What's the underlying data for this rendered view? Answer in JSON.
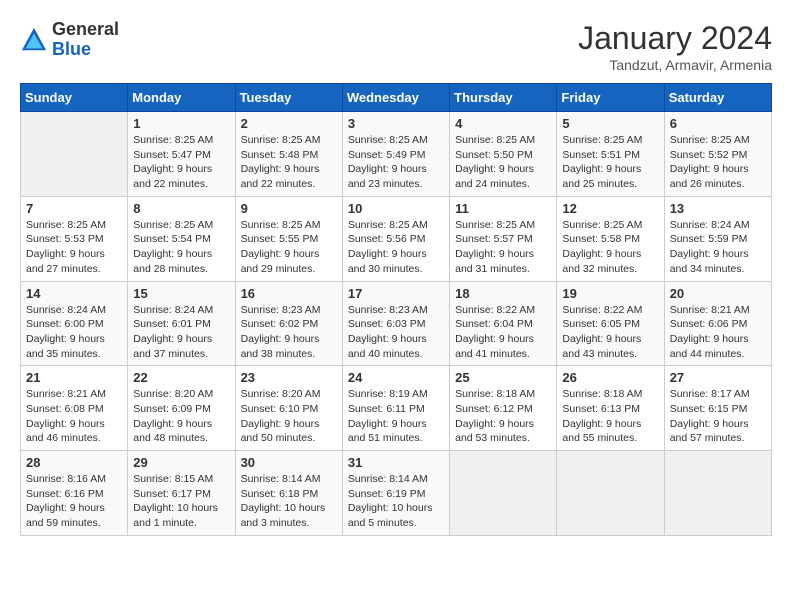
{
  "header": {
    "logo_general": "General",
    "logo_blue": "Blue",
    "month_title": "January 2024",
    "location": "Tandzut, Armavir, Armenia"
  },
  "days_of_week": [
    "Sunday",
    "Monday",
    "Tuesday",
    "Wednesday",
    "Thursday",
    "Friday",
    "Saturday"
  ],
  "weeks": [
    [
      {
        "day": "",
        "info": ""
      },
      {
        "day": "1",
        "info": "Sunrise: 8:25 AM\nSunset: 5:47 PM\nDaylight: 9 hours\nand 22 minutes."
      },
      {
        "day": "2",
        "info": "Sunrise: 8:25 AM\nSunset: 5:48 PM\nDaylight: 9 hours\nand 22 minutes."
      },
      {
        "day": "3",
        "info": "Sunrise: 8:25 AM\nSunset: 5:49 PM\nDaylight: 9 hours\nand 23 minutes."
      },
      {
        "day": "4",
        "info": "Sunrise: 8:25 AM\nSunset: 5:50 PM\nDaylight: 9 hours\nand 24 minutes."
      },
      {
        "day": "5",
        "info": "Sunrise: 8:25 AM\nSunset: 5:51 PM\nDaylight: 9 hours\nand 25 minutes."
      },
      {
        "day": "6",
        "info": "Sunrise: 8:25 AM\nSunset: 5:52 PM\nDaylight: 9 hours\nand 26 minutes."
      }
    ],
    [
      {
        "day": "7",
        "info": "Sunrise: 8:25 AM\nSunset: 5:53 PM\nDaylight: 9 hours\nand 27 minutes."
      },
      {
        "day": "8",
        "info": "Sunrise: 8:25 AM\nSunset: 5:54 PM\nDaylight: 9 hours\nand 28 minutes."
      },
      {
        "day": "9",
        "info": "Sunrise: 8:25 AM\nSunset: 5:55 PM\nDaylight: 9 hours\nand 29 minutes."
      },
      {
        "day": "10",
        "info": "Sunrise: 8:25 AM\nSunset: 5:56 PM\nDaylight: 9 hours\nand 30 minutes."
      },
      {
        "day": "11",
        "info": "Sunrise: 8:25 AM\nSunset: 5:57 PM\nDaylight: 9 hours\nand 31 minutes."
      },
      {
        "day": "12",
        "info": "Sunrise: 8:25 AM\nSunset: 5:58 PM\nDaylight: 9 hours\nand 32 minutes."
      },
      {
        "day": "13",
        "info": "Sunrise: 8:24 AM\nSunset: 5:59 PM\nDaylight: 9 hours\nand 34 minutes."
      }
    ],
    [
      {
        "day": "14",
        "info": "Sunrise: 8:24 AM\nSunset: 6:00 PM\nDaylight: 9 hours\nand 35 minutes."
      },
      {
        "day": "15",
        "info": "Sunrise: 8:24 AM\nSunset: 6:01 PM\nDaylight: 9 hours\nand 37 minutes."
      },
      {
        "day": "16",
        "info": "Sunrise: 8:23 AM\nSunset: 6:02 PM\nDaylight: 9 hours\nand 38 minutes."
      },
      {
        "day": "17",
        "info": "Sunrise: 8:23 AM\nSunset: 6:03 PM\nDaylight: 9 hours\nand 40 minutes."
      },
      {
        "day": "18",
        "info": "Sunrise: 8:22 AM\nSunset: 6:04 PM\nDaylight: 9 hours\nand 41 minutes."
      },
      {
        "day": "19",
        "info": "Sunrise: 8:22 AM\nSunset: 6:05 PM\nDaylight: 9 hours\nand 43 minutes."
      },
      {
        "day": "20",
        "info": "Sunrise: 8:21 AM\nSunset: 6:06 PM\nDaylight: 9 hours\nand 44 minutes."
      }
    ],
    [
      {
        "day": "21",
        "info": "Sunrise: 8:21 AM\nSunset: 6:08 PM\nDaylight: 9 hours\nand 46 minutes."
      },
      {
        "day": "22",
        "info": "Sunrise: 8:20 AM\nSunset: 6:09 PM\nDaylight: 9 hours\nand 48 minutes."
      },
      {
        "day": "23",
        "info": "Sunrise: 8:20 AM\nSunset: 6:10 PM\nDaylight: 9 hours\nand 50 minutes."
      },
      {
        "day": "24",
        "info": "Sunrise: 8:19 AM\nSunset: 6:11 PM\nDaylight: 9 hours\nand 51 minutes."
      },
      {
        "day": "25",
        "info": "Sunrise: 8:18 AM\nSunset: 6:12 PM\nDaylight: 9 hours\nand 53 minutes."
      },
      {
        "day": "26",
        "info": "Sunrise: 8:18 AM\nSunset: 6:13 PM\nDaylight: 9 hours\nand 55 minutes."
      },
      {
        "day": "27",
        "info": "Sunrise: 8:17 AM\nSunset: 6:15 PM\nDaylight: 9 hours\nand 57 minutes."
      }
    ],
    [
      {
        "day": "28",
        "info": "Sunrise: 8:16 AM\nSunset: 6:16 PM\nDaylight: 9 hours\nand 59 minutes."
      },
      {
        "day": "29",
        "info": "Sunrise: 8:15 AM\nSunset: 6:17 PM\nDaylight: 10 hours\nand 1 minute."
      },
      {
        "day": "30",
        "info": "Sunrise: 8:14 AM\nSunset: 6:18 PM\nDaylight: 10 hours\nand 3 minutes."
      },
      {
        "day": "31",
        "info": "Sunrise: 8:14 AM\nSunset: 6:19 PM\nDaylight: 10 hours\nand 5 minutes."
      },
      {
        "day": "",
        "info": ""
      },
      {
        "day": "",
        "info": ""
      },
      {
        "day": "",
        "info": ""
      }
    ]
  ]
}
